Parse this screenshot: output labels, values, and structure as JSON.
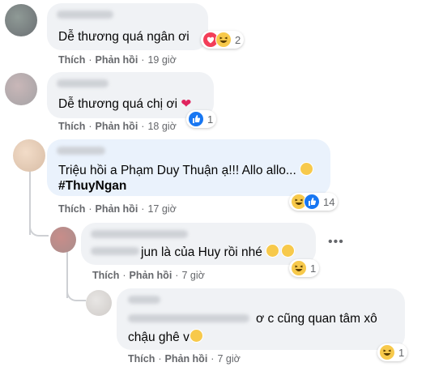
{
  "labels": {
    "like": "Thích",
    "reply": "Phản hồi",
    "dot": "·"
  },
  "comments": [
    {
      "text": "Dễ thương quá ngân ơi",
      "time": "19 giờ",
      "reaction_count": "2",
      "reaction_icons": [
        "heart-icon",
        "haha-icon"
      ]
    },
    {
      "text": "Dễ thương quá chị ơi",
      "time": "18 giờ",
      "reaction_count": "1",
      "reaction_icons": [
        "like-icon"
      ]
    },
    {
      "text": "Triệu hồi a Phạm Duy Thuận ạ!!! Allo allo...",
      "tag": "#ThuyNgan",
      "time": "17 giờ",
      "reaction_count": "14",
      "reaction_icons": [
        "haha-icon",
        "like-icon"
      ]
    },
    {
      "text": "jun là của Huy rồi nhé",
      "time": "7 giờ",
      "reaction_count": "1",
      "reaction_icons": [
        "haha-icon"
      ]
    },
    {
      "text_line1": "ơ c cũng quan tâm xô",
      "text_line2": "chậu ghê v",
      "time": "7 giờ",
      "reaction_count": "1",
      "reaction_icons": [
        "haha-icon"
      ]
    }
  ],
  "colors": {
    "bubble": "#f0f2f5",
    "highlight": "#eaf2fc",
    "meta": "#65676b",
    "heart": "#f33e58",
    "like": "#1877f2",
    "haha": "#f7c94b"
  }
}
